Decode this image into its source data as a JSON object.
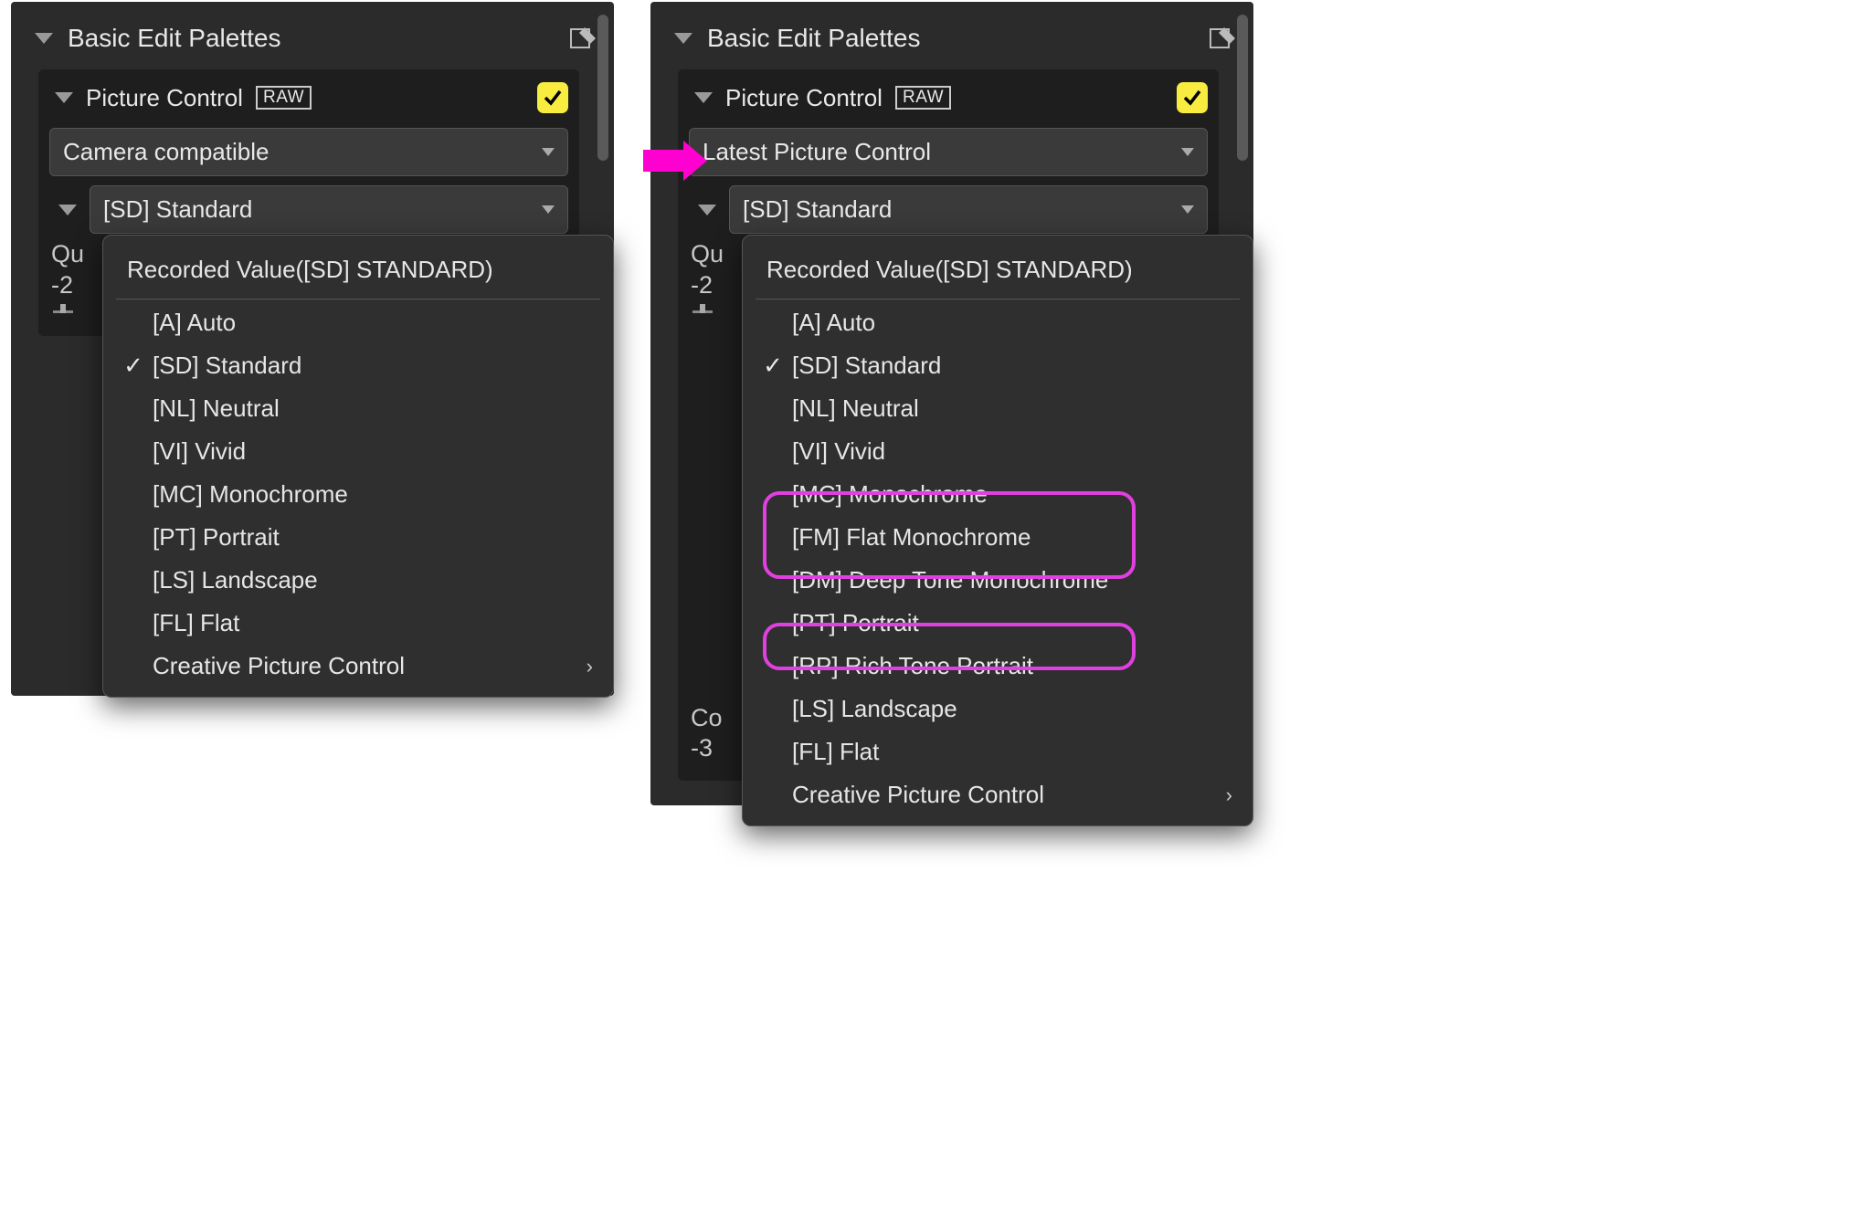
{
  "left": {
    "section_title": "Basic Edit Palettes",
    "sub_title": "Picture Control",
    "raw_label": "RAW",
    "select_main": "Camera compatible",
    "select_sub": "[SD] Standard",
    "obscured_top": "Qu",
    "obscured_bottom": "-2",
    "menu_title": "Recorded Value([SD] STANDARD)",
    "items": {
      "auto": "[A] Auto",
      "standard": "[SD] Standard",
      "neutral": "[NL] Neutral",
      "vivid": "[VI] Vivid",
      "mono": "[MC] Monochrome",
      "portrait": "[PT] Portrait",
      "landscape": "[LS] Landscape",
      "flat": "[FL] Flat",
      "creative": "Creative Picture Control"
    }
  },
  "right": {
    "section_title": "Basic Edit Palettes",
    "sub_title": "Picture Control",
    "raw_label": "RAW",
    "select_main": "Latest Picture Control",
    "select_sub": "[SD] Standard",
    "obscured_top": "Qu",
    "obscured_bottom": "-2",
    "obscured2_top": "Co",
    "obscured2_bottom": "-3",
    "menu_title": "Recorded Value([SD] STANDARD)",
    "items": {
      "auto": "[A] Auto",
      "standard": "[SD] Standard",
      "neutral": "[NL] Neutral",
      "vivid": "[VI] Vivid",
      "mono": "[MC] Monochrome",
      "flatmono": "[FM] Flat Monochrome",
      "deepmono": "[DM] Deep Tone Monochrome",
      "portrait": "[PT] Portrait",
      "richportrait": "[RP] Rich Tone Portrait",
      "landscape": "[LS] Landscape",
      "flat": "[FL] Flat",
      "creative": "Creative Picture Control"
    }
  }
}
